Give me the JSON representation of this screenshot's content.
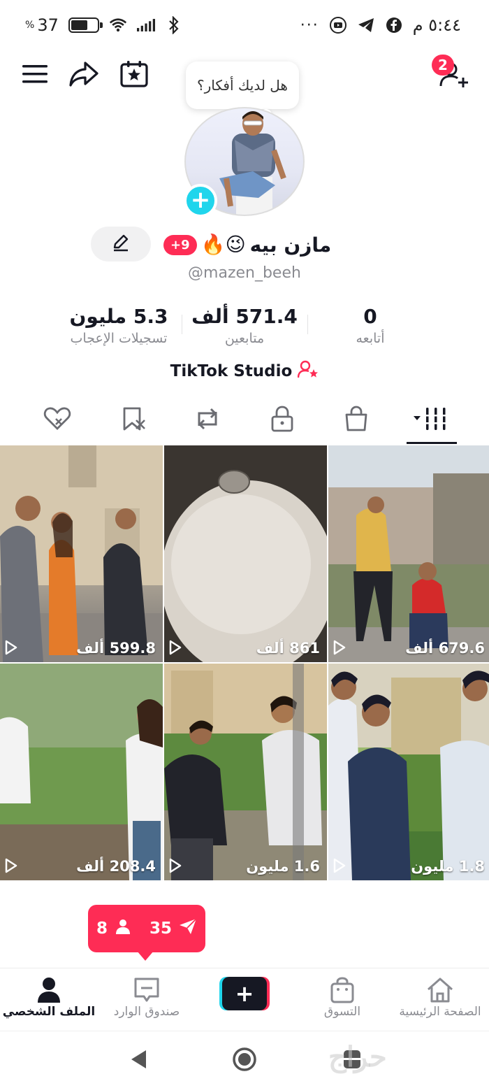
{
  "statusbar": {
    "battery_level": "37",
    "battery_fraction": 0.62,
    "time": "٥:٤٤ م",
    "more": "···"
  },
  "topnav": {
    "friend_requests_count": "2"
  },
  "bubble": {
    "text": "هل لديك أفكار؟"
  },
  "profile": {
    "display_name": "مازن بيه",
    "emojis": "🔥😉",
    "badge": "+9",
    "username": "@mazen_beeh"
  },
  "stats": [
    {
      "value": "0",
      "label": "أتابعه"
    },
    {
      "value": "571.4 ألف",
      "label": "متابعين"
    },
    {
      "value": "5.3 مليون",
      "label": "تسجيلات الإعجاب"
    }
  ],
  "studio": {
    "label": "TikTok Studio"
  },
  "videos": [
    {
      "views": "599.8 ألف"
    },
    {
      "views": "861 ألف"
    },
    {
      "views": "679.6 ألف"
    },
    {
      "views": "208.4 ألف"
    },
    {
      "views": "1.6 مليون"
    },
    {
      "views": "1.8 مليون"
    }
  ],
  "activity": {
    "people": "8",
    "shares": "35"
  },
  "bottomnav": {
    "profile": "الملف الشخصي",
    "inbox": "صندوق الوارد",
    "shop": "التسوق",
    "home": "الصفحة الرئيسية",
    "create": "+"
  },
  "watermark": "حراج",
  "colors": {
    "accent": "#fe2c55",
    "cyan": "#20d5ec",
    "text": "#161823",
    "muted": "#8a8b91"
  }
}
